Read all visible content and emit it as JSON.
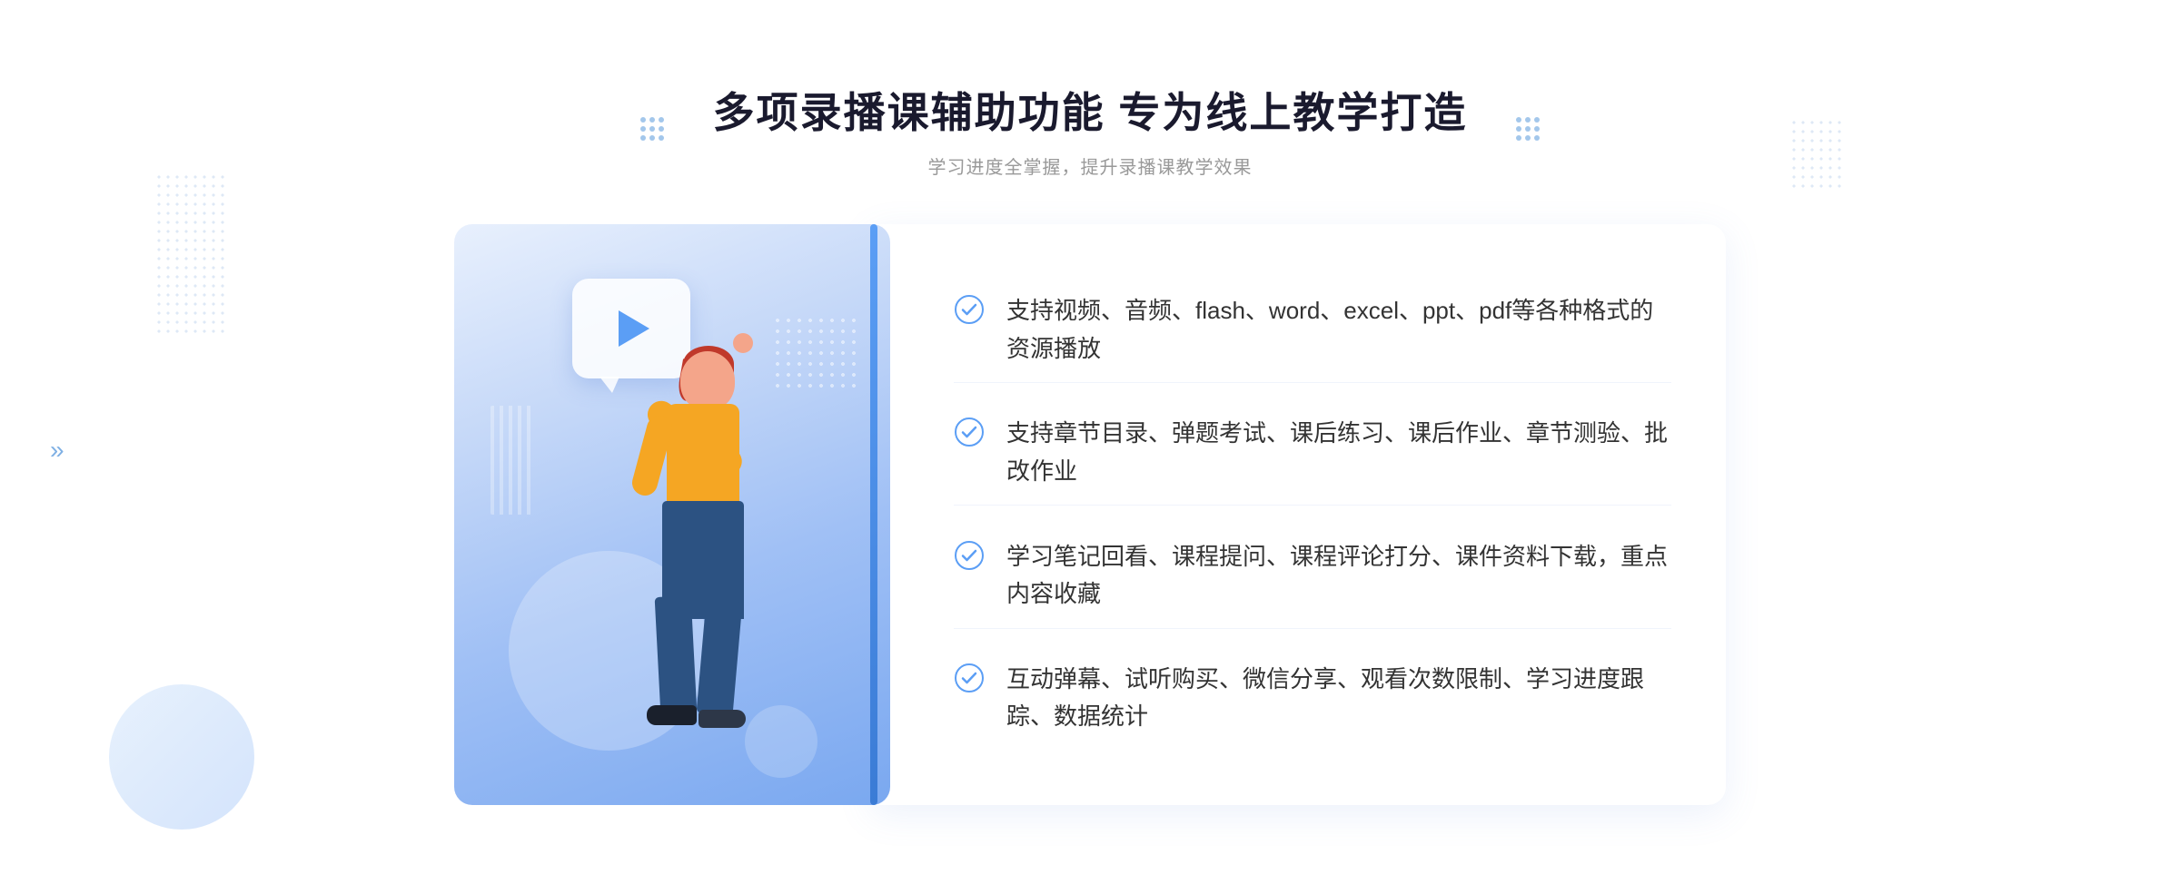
{
  "page": {
    "title": "多项录播课辅助功能 专为线上教学打造",
    "subtitle": "学习进度全掌握，提升录播课教学效果",
    "decorative_dots_title_left": "⁞⁞",
    "decorative_dots_title_right": "⁞⁞"
  },
  "features": [
    {
      "id": 1,
      "text": "支持视频、音频、flash、word、excel、ppt、pdf等各种格式的资源播放"
    },
    {
      "id": 2,
      "text": "支持章节目录、弹题考试、课后练习、课后作业、章节测验、批改作业"
    },
    {
      "id": 3,
      "text": "学习笔记回看、课程提问、课程评论打分、课件资料下载，重点内容收藏"
    },
    {
      "id": 4,
      "text": "互动弹幕、试听购买、微信分享、观看次数限制、学习进度跟踪、数据统计"
    }
  ],
  "colors": {
    "primary": "#4a86e8",
    "check": "#5b9ef5",
    "title": "#1a1a2e",
    "text": "#333333",
    "subtitle": "#999999"
  },
  "icons": {
    "check": "check-circle",
    "play": "play-triangle",
    "arrow_left": "«"
  }
}
